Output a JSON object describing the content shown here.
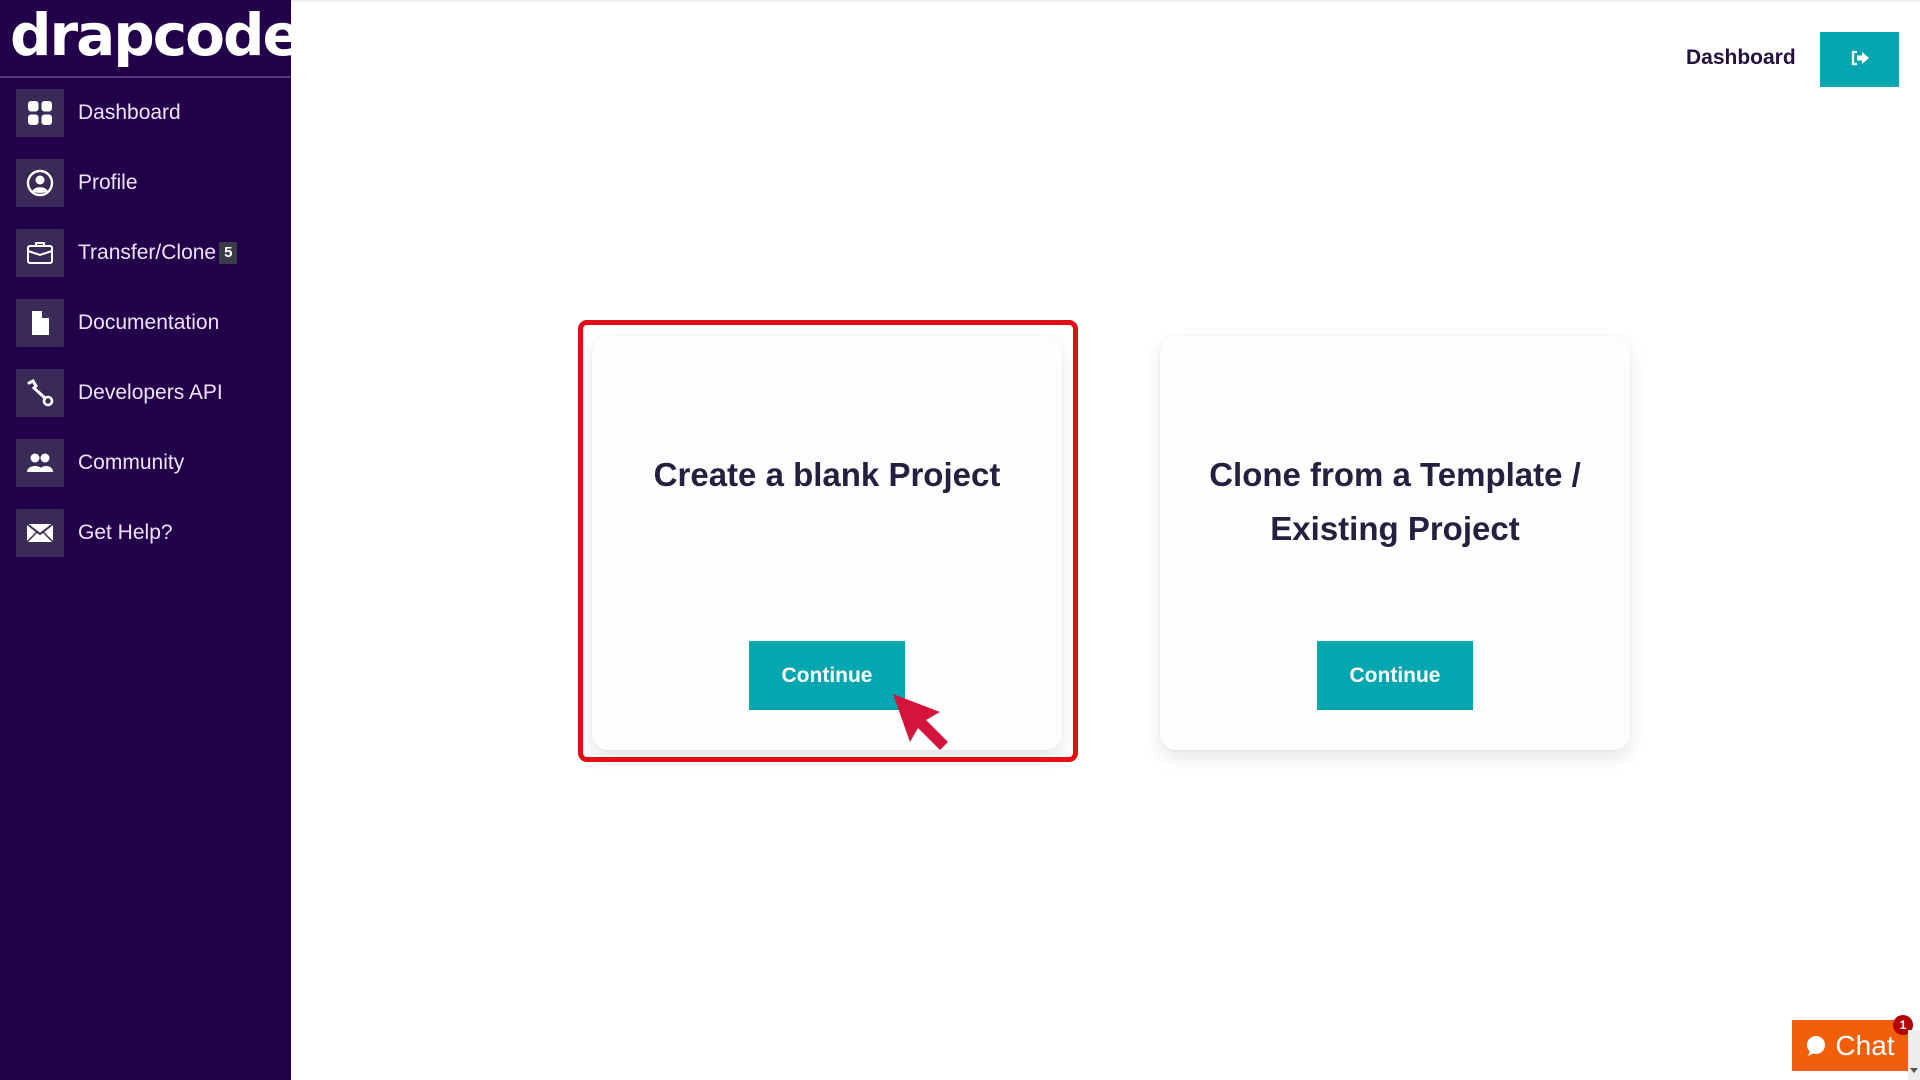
{
  "app": {
    "logo_text": "drapcode"
  },
  "sidebar": {
    "items": [
      {
        "label": "Dashboard",
        "icon": "grid-icon"
      },
      {
        "label": "Profile",
        "icon": "user-circle-icon"
      },
      {
        "label": "Transfer/Clone",
        "icon": "briefcase-icon",
        "badge": "5"
      },
      {
        "label": "Documentation",
        "icon": "file-icon"
      },
      {
        "label": "Developers API",
        "icon": "wrench-icon"
      },
      {
        "label": "Community",
        "icon": "users-icon"
      },
      {
        "label": "Get Help?",
        "icon": "envelope-icon"
      }
    ]
  },
  "header": {
    "dashboard_label": "Dashboard",
    "logout_icon": "sign-out-icon"
  },
  "cards": [
    {
      "title": "Create a blank Project",
      "button_label": "Continue",
      "highlighted": true
    },
    {
      "title": "Clone from a Template / Existing Project",
      "button_label": "Continue",
      "highlighted": false
    }
  ],
  "chat": {
    "label": "Chat",
    "unread_count": "1"
  },
  "colors": {
    "sidebar_bg": "#22004a",
    "accent": "#04a6b0",
    "highlight": "#e20f16",
    "cursor": "#d4143c",
    "chat": "#f25f0a"
  }
}
